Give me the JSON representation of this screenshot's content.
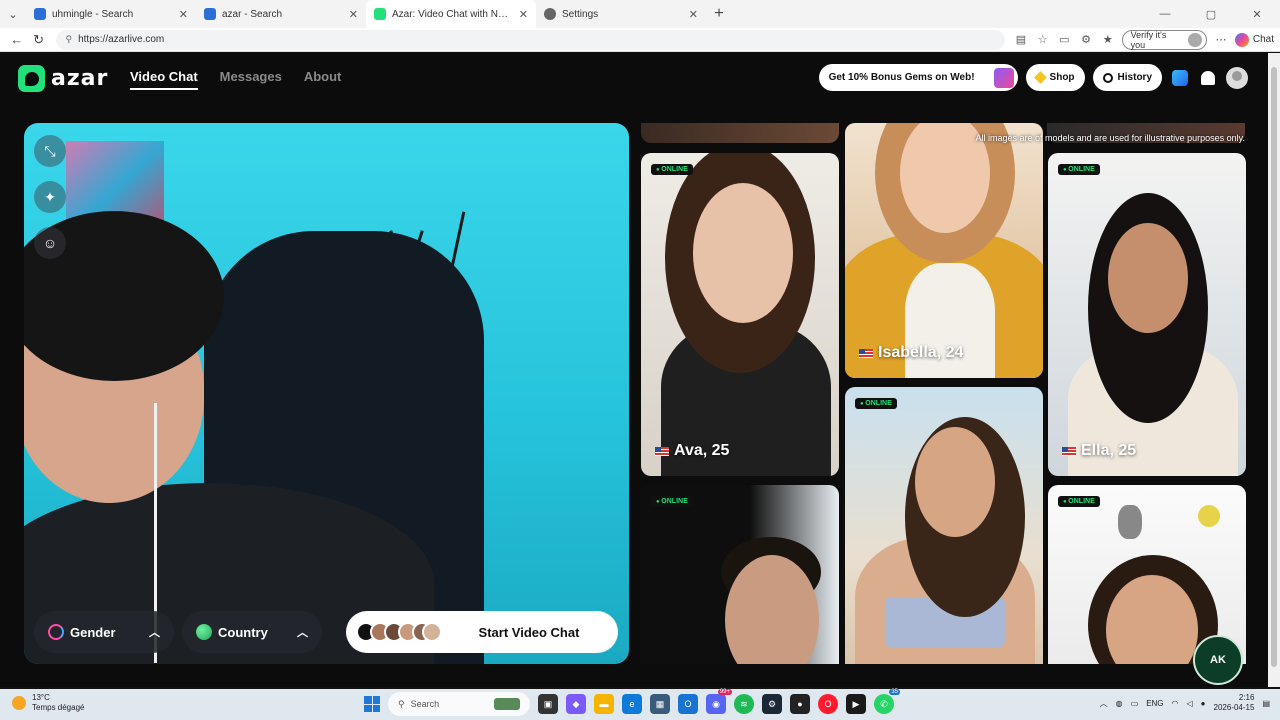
{
  "browser": {
    "tabs": [
      {
        "title": "uhmingle - Search",
        "favicon_color": "#2b6fd6",
        "active": false
      },
      {
        "title": "azar - Search",
        "favicon_color": "#2b6fd6",
        "active": false
      },
      {
        "title": "Azar: Video Chat with New Pe",
        "favicon_color": "#22e07a",
        "active": true
      },
      {
        "title": "Settings",
        "favicon_color": "#666666",
        "active": false
      }
    ],
    "url": "https://azarlive.com",
    "verify_label": "Verify it's you",
    "copilot_label": "Chat"
  },
  "header": {
    "logo_text": "azar",
    "nav": [
      {
        "label": "Video Chat",
        "active": true
      },
      {
        "label": "Messages",
        "active": false
      },
      {
        "label": "About",
        "active": false
      }
    ],
    "bonus_label": "Get 10% Bonus Gems on Web!",
    "shop_label": "Shop",
    "history_label": "History"
  },
  "video": {
    "filters": [
      {
        "label": "Gender",
        "icon": "gender-icon"
      },
      {
        "label": "Country",
        "icon": "globe-icon"
      }
    ],
    "start_label": "Start Video Chat"
  },
  "gallery": {
    "disclaimer": "All images are of models and are used for illustrative purposes only.",
    "online_label": "ONLINE",
    "cards": [
      {
        "name": "Ava, 25",
        "online": true
      },
      {
        "name": "Isabella, 24",
        "online": false
      },
      {
        "name": "Ella, 25",
        "online": true
      },
      {
        "name": "",
        "online": true
      },
      {
        "name": "",
        "online": true
      },
      {
        "name": "",
        "online": true
      }
    ]
  },
  "badge_text": "AK",
  "taskbar": {
    "weather_temp": "13°C",
    "weather_desc": "Temps dégagé",
    "search_placeholder": "Search",
    "lang": "ENG",
    "time": "2:16",
    "date": "2026-04-15",
    "badges": {
      "discord": "99+",
      "whatsapp": "35"
    }
  },
  "colors": {
    "brand": "#22e07a",
    "accent_text": "#ffffff"
  }
}
